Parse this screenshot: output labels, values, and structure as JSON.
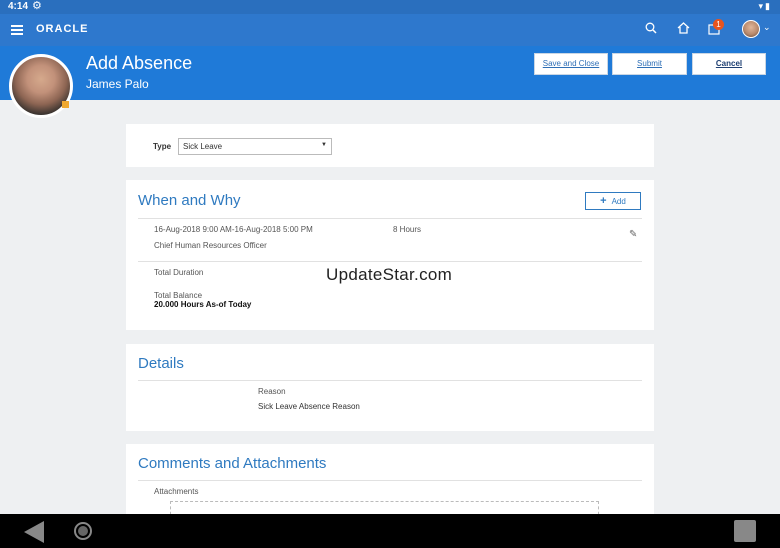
{
  "status_bar": {
    "time": "4:14"
  },
  "app": {
    "logo": "ORACLE",
    "notification_count": "1"
  },
  "page": {
    "title": "Add Absence",
    "person": "James Palo"
  },
  "buttons": {
    "save_close": "Save and Close",
    "submit": "Submit",
    "cancel": "Cancel"
  },
  "type": {
    "label": "Type",
    "value": "Sick Leave"
  },
  "when_why": {
    "title": "When and Why",
    "add_label": "Add",
    "entry": {
      "dates": "16-Aug-2018 9:00 AM-16-Aug-2018 5:00 PM",
      "duration": "8 Hours",
      "role": "Chief Human Resources Officer"
    },
    "total_duration_label": "Total Duration",
    "total_balance_label": "Total Balance",
    "total_balance_value": "20.000 Hours As-of Today"
  },
  "details": {
    "title": "Details",
    "reason_label": "Reason",
    "reason_value": "Sick Leave Absence Reason"
  },
  "comments": {
    "title": "Comments and Attachments",
    "attachments_label": "Attachments"
  },
  "watermark": "UpdateStar.com",
  "colors": {
    "header": "#2e78cd",
    "page_header": "#1f7ad8",
    "accent": "#2f7ac0"
  }
}
